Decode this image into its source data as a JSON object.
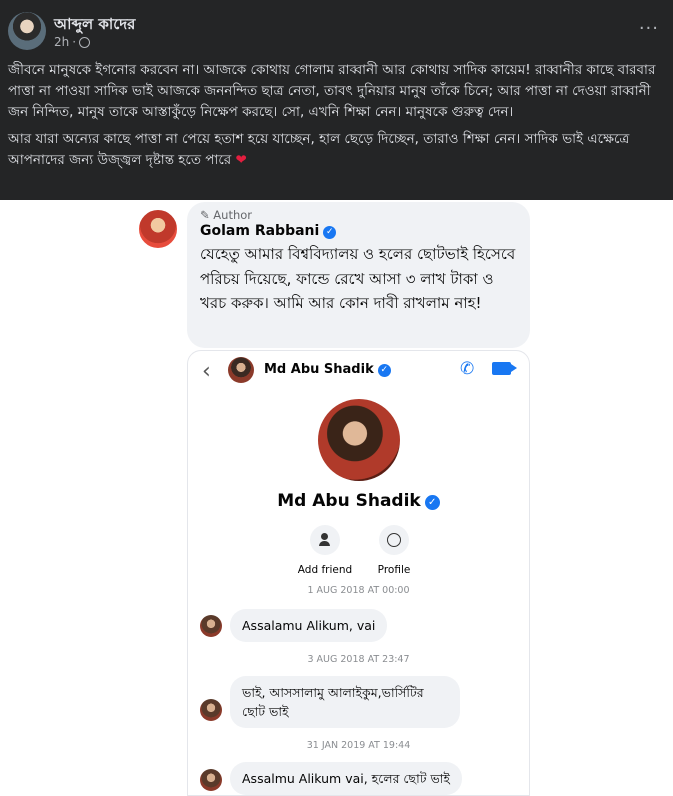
{
  "post": {
    "author": "আব্দুল কাদের",
    "time": "2h",
    "more": "···",
    "paragraph1": "জীবনে মানুষকে ইগনোর করবেন না। আজকে কোথায় গোলাম রাব্বানী আর কোথায় সাদিক কায়েম! রাব্বানীর কাছে বারবার পাত্তা না পাওয়া সাদিক ভাই আজকে জননন্দিত ছাত্র নেতা, তাবৎ দুনিয়ার মানুষ তাঁকে চিনে; আর পাত্তা না দেওয়া রাব্বানী জন নিন্দিত, মানুষ তাকে আস্তাকুঁড়ে নিক্ষেপ করছে। সো, এখনি শিক্ষা নেন। মানুষকে গুরুত্ব দেন।",
    "paragraph2": "আর যারা অন্যের কাছে পাত্তা না পেয়ে হতাশ হয়ে যাচ্ছেন, হাল ছেড়ে দিচ্ছেন, তারাও শিক্ষা নেন। সাদিক ভাই এক্ষেত্রে আপনাদের জন্য উজ্জ্বল দৃষ্টান্ত হতে পারে",
    "heart": "❤"
  },
  "comment": {
    "author_tag": "✎ Author",
    "name": "Golam Rabbani",
    "verified": "✓",
    "text": "যেহেতু আমার বিশ্ববিদ্যালয় ও হলের ছোটভাই হিসেবে পরিচয় দিয়েছে, ফান্ডে রেখে আসা ৩ লাখ টাকা ও খরচ করুক। আমি আর কোন দাবী রাখলাম নাহ!"
  },
  "messenger": {
    "back": "‹",
    "title": "Md Abu Shadik",
    "call": "✆",
    "profile_name": "Md Abu Shadik",
    "add_friend_label": "Add friend",
    "profile_label": "Profile",
    "messages": [
      {
        "date": "1 AUG 2018 AT 00:00",
        "text": "Assalamu Alikum, vai"
      },
      {
        "date": "3 AUG 2018 AT 23:47",
        "text": "ভাই, আসসালামু আলাইকুম,ভার্সিটির ছোট ভাই"
      },
      {
        "date": "31 JAN 2019 AT 19:44",
        "text": "Assalmu Alikum vai, হলের ছোট ভাই"
      }
    ]
  },
  "colors": {
    "post_bg": "#242526",
    "accent_blue": "#1877f2",
    "bubble_bg": "#f0f2f5"
  }
}
